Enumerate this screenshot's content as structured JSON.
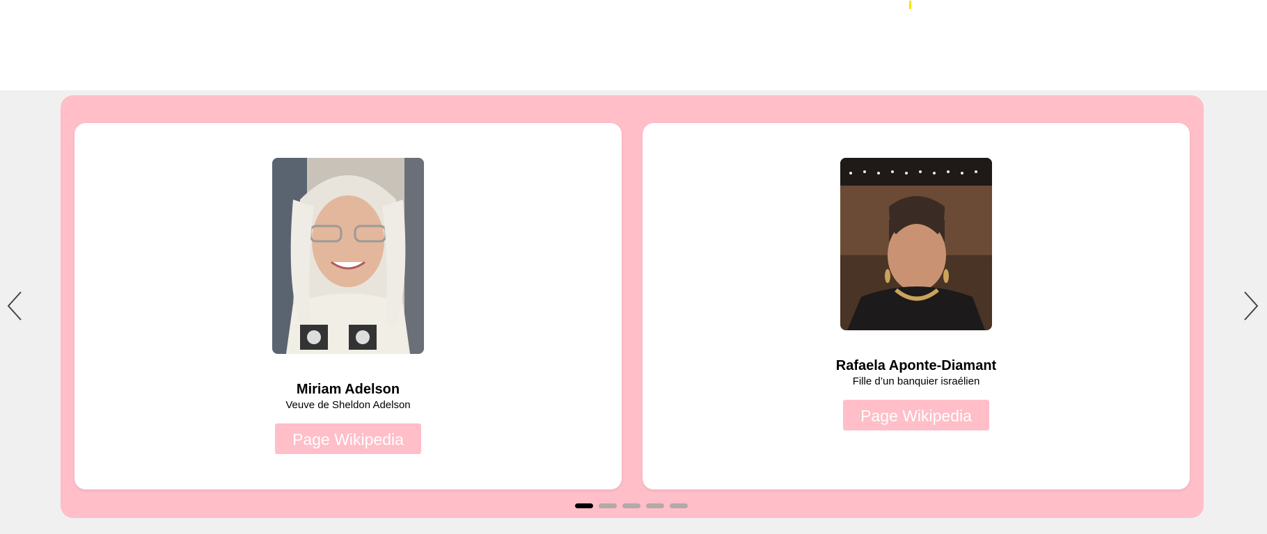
{
  "colors": {
    "carousel_bg": "#ffbec8",
    "button_bg": "#ffbec8",
    "button_text": "#ffffff",
    "page_band_bg": "#f0f0f0",
    "dot_inactive": "#b4a8aa",
    "dot_active": "#000000"
  },
  "carousel": {
    "prev_icon": "chevron-left-icon",
    "next_icon": "chevron-right-icon",
    "active_slide_index": 0,
    "dot_count": 5,
    "cards": [
      {
        "name": "Miriam Adelson",
        "description": "Veuve de Sheldon Adelson",
        "button_label": "Page Wikipedia",
        "image": "portrait-photo"
      },
      {
        "name": "Rafaela Aponte-Diamant",
        "description": "Fille d’un banquier israélien",
        "button_label": "Page Wikipedia",
        "image": "portrait-photo"
      }
    ]
  }
}
